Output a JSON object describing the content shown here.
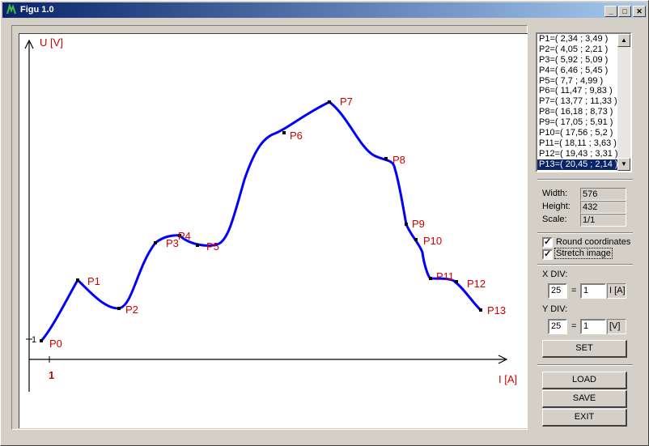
{
  "window": {
    "title": "Figu 1.0"
  },
  "chart": {
    "y_axis_label": "U [V]",
    "x_axis_label": "I [A]",
    "x_tick": "1",
    "y_tick": "1",
    "curve_color": "#0000ff",
    "label_color": "#cc0000",
    "points": [
      {
        "name": "P0"
      },
      {
        "name": "P1"
      },
      {
        "name": "P2"
      },
      {
        "name": "P3"
      },
      {
        "name": "P4"
      },
      {
        "name": "P5"
      },
      {
        "name": "P6"
      },
      {
        "name": "P7"
      },
      {
        "name": "P8"
      },
      {
        "name": "P9"
      },
      {
        "name": "P10"
      },
      {
        "name": "P11"
      },
      {
        "name": "P12"
      },
      {
        "name": "P13"
      }
    ]
  },
  "points_list": [
    "P1=( 2,34 ; 3,49 )",
    "P2=( 4,05 ; 2,21 )",
    "P3=( 5,92 ; 5,09 )",
    "P4=( 6,46 ; 5,45 )",
    "P5=( 7,7 ; 4,99 )",
    "P6=( 11,47 ; 9,83 )",
    "P7=( 13,77 ; 11,33 )",
    "P8=( 16,18 ; 8,73 )",
    "P9=( 17,05 ; 5,91 )",
    "P10=( 17,56 ; 5,2 )",
    "P11=( 18,11 ; 3,63 )",
    "P12=( 19,43 ; 3,31 )",
    "P13=( 20,45 ; 2,14 )"
  ],
  "selected_index": 12,
  "info": {
    "width_label": "Width:",
    "width_value": "576",
    "height_label": "Height:",
    "height_value": "432",
    "scale_label": "Scale:",
    "scale_value": "1/1"
  },
  "options": {
    "round_label": "Round coordinates",
    "round_checked": true,
    "stretch_label": "Stretch image",
    "stretch_checked": true
  },
  "xdiv": {
    "label": "X DIV:",
    "pixels": "25",
    "eq": "=",
    "value": "1",
    "unit": "I [A]"
  },
  "ydiv": {
    "label": "Y DIV:",
    "pixels": "25",
    "eq": "=",
    "value": "1",
    "unit": "[V]"
  },
  "buttons": {
    "set": "SET",
    "load": "LOAD",
    "save": "SAVE",
    "exit": "EXIT"
  }
}
